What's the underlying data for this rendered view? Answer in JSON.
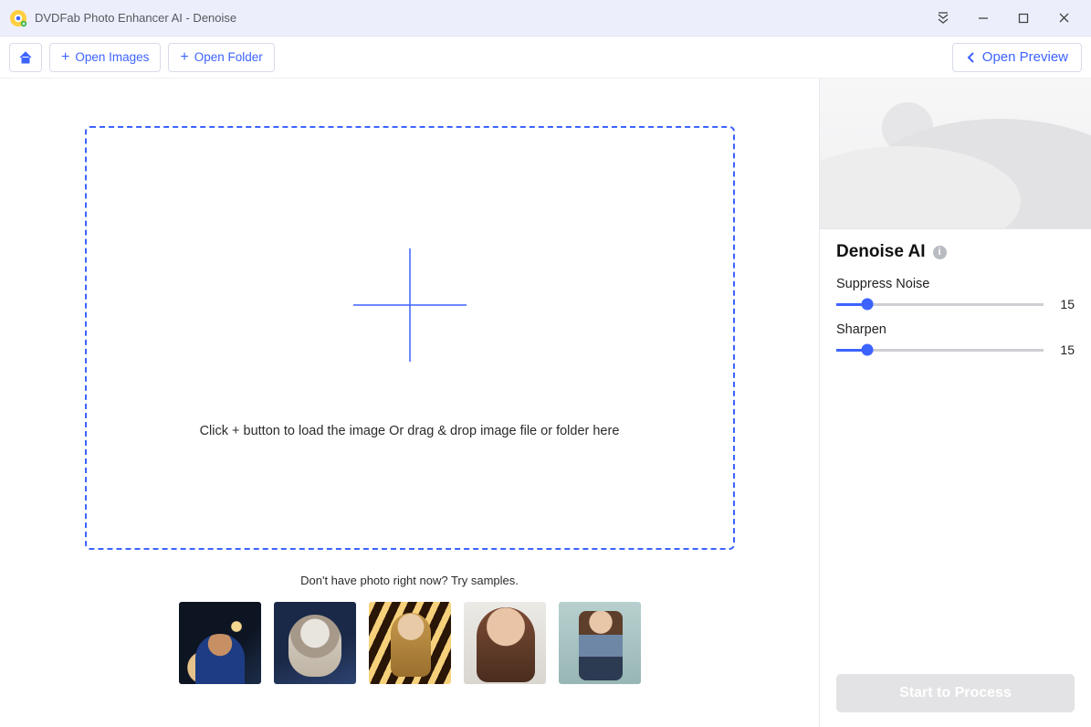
{
  "titlebar": {
    "title": "DVDFab Photo Enhancer AI - Denoise"
  },
  "toolbar": {
    "open_images_label": "Open Images",
    "open_folder_label": "Open Folder",
    "open_preview_label": "Open Preview"
  },
  "dropzone": {
    "hint": "Click + button to load the image Or drag & drop image file or folder here"
  },
  "samples": {
    "caption": "Don't have photo right now? Try samples.",
    "items": [
      {
        "name": "sample-1"
      },
      {
        "name": "sample-2"
      },
      {
        "name": "sample-3"
      },
      {
        "name": "sample-4"
      },
      {
        "name": "sample-5"
      }
    ]
  },
  "panel": {
    "title": "Denoise AI",
    "sliders": [
      {
        "key": "suppress_noise",
        "label": "Suppress Noise",
        "value": 15,
        "min": 0,
        "max": 100
      },
      {
        "key": "sharpen",
        "label": "Sharpen",
        "value": 15,
        "min": 0,
        "max": 100
      }
    ],
    "process_label": "Start to Process"
  }
}
